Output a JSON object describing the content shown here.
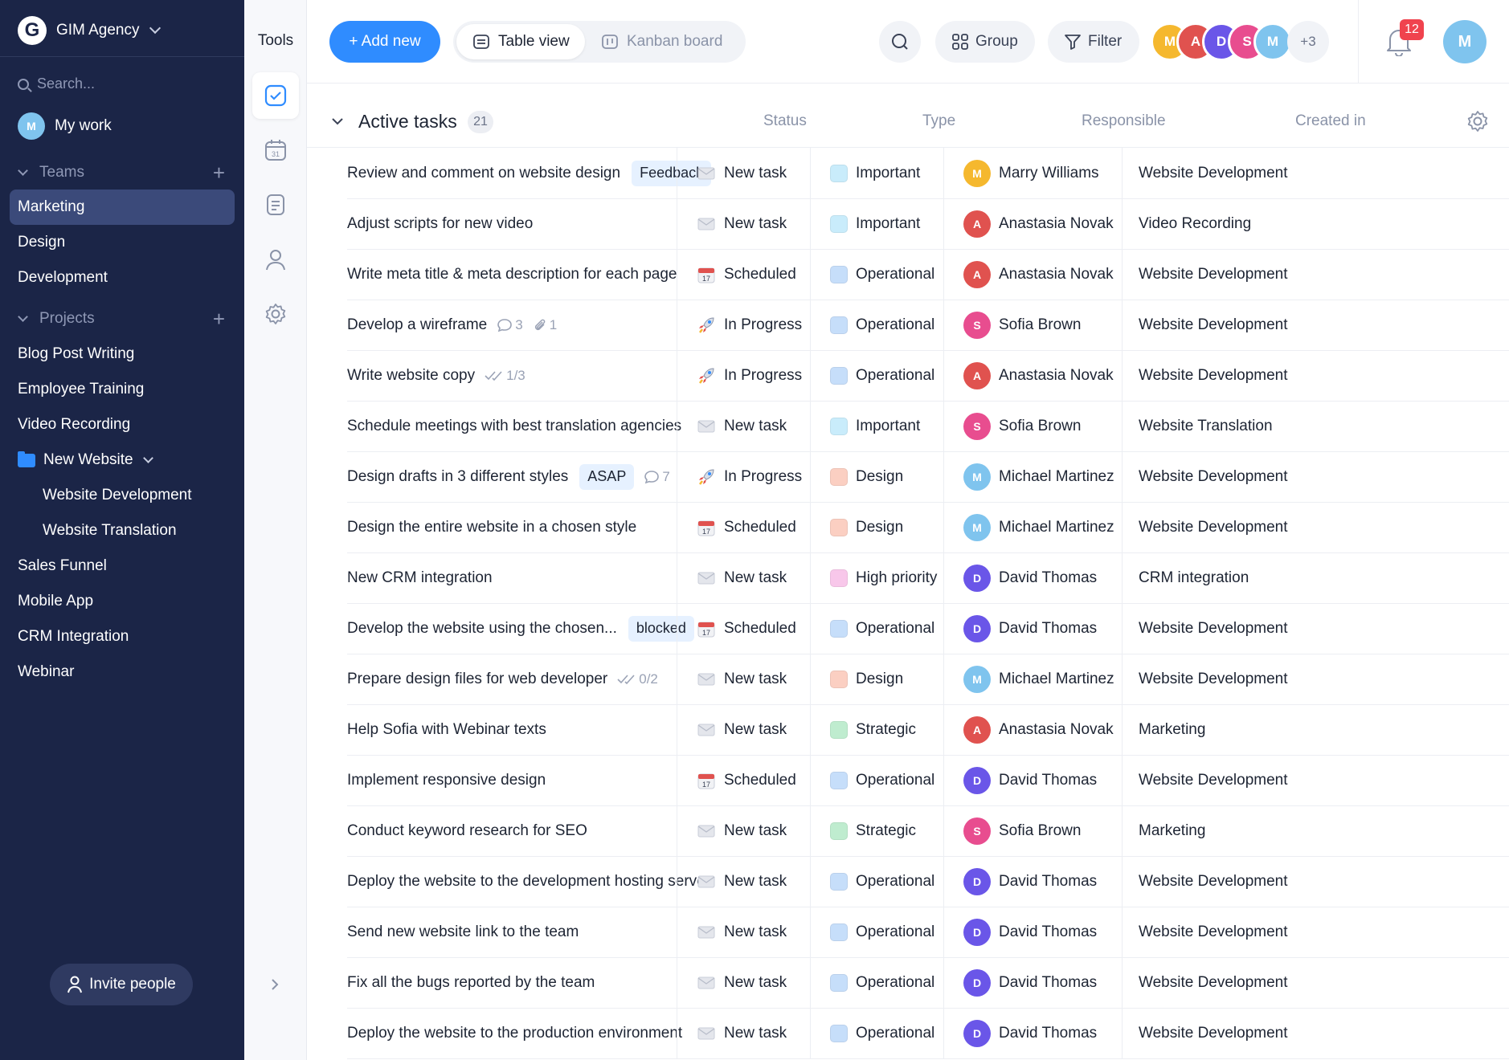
{
  "workspace": {
    "name": "GIM Agency"
  },
  "sidebar": {
    "search_placeholder": "Search...",
    "my_work": "My work",
    "teams_label": "Teams",
    "projects_label": "Projects",
    "teams": [
      {
        "label": "Marketing"
      },
      {
        "label": "Design"
      },
      {
        "label": "Development"
      }
    ],
    "projects": [
      {
        "label": "Blog Post Writing"
      },
      {
        "label": "Employee Training"
      },
      {
        "label": "Video Recording"
      }
    ],
    "folder": {
      "label": "New Website",
      "children": [
        {
          "label": "Website Development"
        },
        {
          "label": "Website Translation"
        }
      ]
    },
    "projects_after": [
      {
        "label": "Sales Funnel"
      },
      {
        "label": "Mobile App"
      },
      {
        "label": "CRM Integration"
      },
      {
        "label": "Webinar"
      }
    ],
    "invite": "Invite people"
  },
  "tools": {
    "title": "Tools",
    "items": [
      "checkbox-icon",
      "calendar-icon",
      "notes-icon",
      "person-icon",
      "settings-icon"
    ],
    "calendar_day": "31"
  },
  "toolbar": {
    "add_new": "+ Add new",
    "table_view": "Table view",
    "kanban_board": "Kanban board",
    "group": "Group",
    "filter": "Filter",
    "avatars_more": "+3",
    "notifications": "12"
  },
  "table": {
    "group_name": "Active tasks",
    "group_count": "21",
    "columns": {
      "status": "Status",
      "type": "Type",
      "responsible": "Responsible",
      "created_in": "Created in"
    },
    "rows": [
      {
        "task": "Review and comment on website design",
        "tag": "Feedback",
        "status": "New task",
        "type": "Important",
        "responsible": "Marry Williams",
        "created": "Website Development"
      },
      {
        "task": "Adjust scripts for new video",
        "status": "New task",
        "type": "Important",
        "responsible": "Anastasia Novak",
        "created": "Video Recording"
      },
      {
        "task": "Write meta title & meta description for each page",
        "status": "Scheduled",
        "type": "Operational",
        "responsible": "Anastasia Novak",
        "created": "Website Development"
      },
      {
        "task": "Develop a wireframe",
        "comments": "3",
        "attachments": "1",
        "status": "In Progress",
        "type": "Operational",
        "responsible": "Sofia Brown",
        "created": "Website Development"
      },
      {
        "task": "Write website copy",
        "checklist": "1/3",
        "status": "In Progress",
        "type": "Operational",
        "responsible": "Anastasia Novak",
        "created": "Website Development"
      },
      {
        "task": "Schedule meetings with best translation agencies",
        "status": "New task",
        "type": "Important",
        "responsible": "Sofia Brown",
        "created": "Website Translation"
      },
      {
        "task": "Design drafts in 3 different styles",
        "tag": "ASAP",
        "comments": "7",
        "status": "In Progress",
        "type": "Design",
        "responsible": "Michael Martinez",
        "created": "Website Development"
      },
      {
        "task": "Design the entire website in a chosen style",
        "status": "Scheduled",
        "type": "Design",
        "responsible": "Michael Martinez",
        "created": "Website Development"
      },
      {
        "task": "New CRM integration",
        "status": "New task",
        "type": "High priority",
        "responsible": "David Thomas",
        "created": "CRM integration"
      },
      {
        "task": "Develop the website using the chosen...",
        "tag": "blocked",
        "status": "Scheduled",
        "type": "Operational",
        "responsible": "David Thomas",
        "created": "Website Development"
      },
      {
        "task": "Prepare design files for web developer",
        "checklist": "0/2",
        "status": "New task",
        "type": "Design",
        "responsible": "Michael Martinez",
        "created": "Website Development"
      },
      {
        "task": "Help Sofia with Webinar texts",
        "status": "New task",
        "type": "Strategic",
        "responsible": "Anastasia Novak",
        "created": "Marketing"
      },
      {
        "task": "Implement responsive design",
        "status": "Scheduled",
        "type": "Operational",
        "responsible": "David Thomas",
        "created": "Website Development"
      },
      {
        "task": "Conduct keyword research for SEO",
        "status": "New task",
        "type": "Strategic",
        "responsible": "Sofia Brown",
        "created": "Marketing"
      },
      {
        "task": "Deploy the website to the development hosting server",
        "status": "New task",
        "type": "Operational",
        "responsible": "David Thomas",
        "created": "Website Development"
      },
      {
        "task": "Send new website link to the team",
        "status": "New task",
        "type": "Operational",
        "responsible": "David Thomas",
        "created": "Website Development"
      },
      {
        "task": "Fix all the bugs reported by the team",
        "status": "New task",
        "type": "Operational",
        "responsible": "David Thomas",
        "created": "Website Development"
      },
      {
        "task": "Deploy the website to the production environment",
        "status": "New task",
        "type": "Operational",
        "responsible": "David Thomas",
        "created": "Website Development"
      }
    ]
  },
  "type_colors": {
    "Important": "#c9ecfb",
    "Operational": "#c6defa",
    "Design": "#fbcfc2",
    "High priority": "#f8c7ea",
    "Strategic": "#bfeccf"
  },
  "status_icons": {
    "New task": "envelope-icon",
    "Scheduled": "calendar-icon",
    "In Progress": "rocket-icon"
  },
  "colors": {
    "sidebar": "#1b2547",
    "accent": "#2f8cff",
    "active_nav": "#3b4a7a",
    "badge": "#f0434e"
  }
}
